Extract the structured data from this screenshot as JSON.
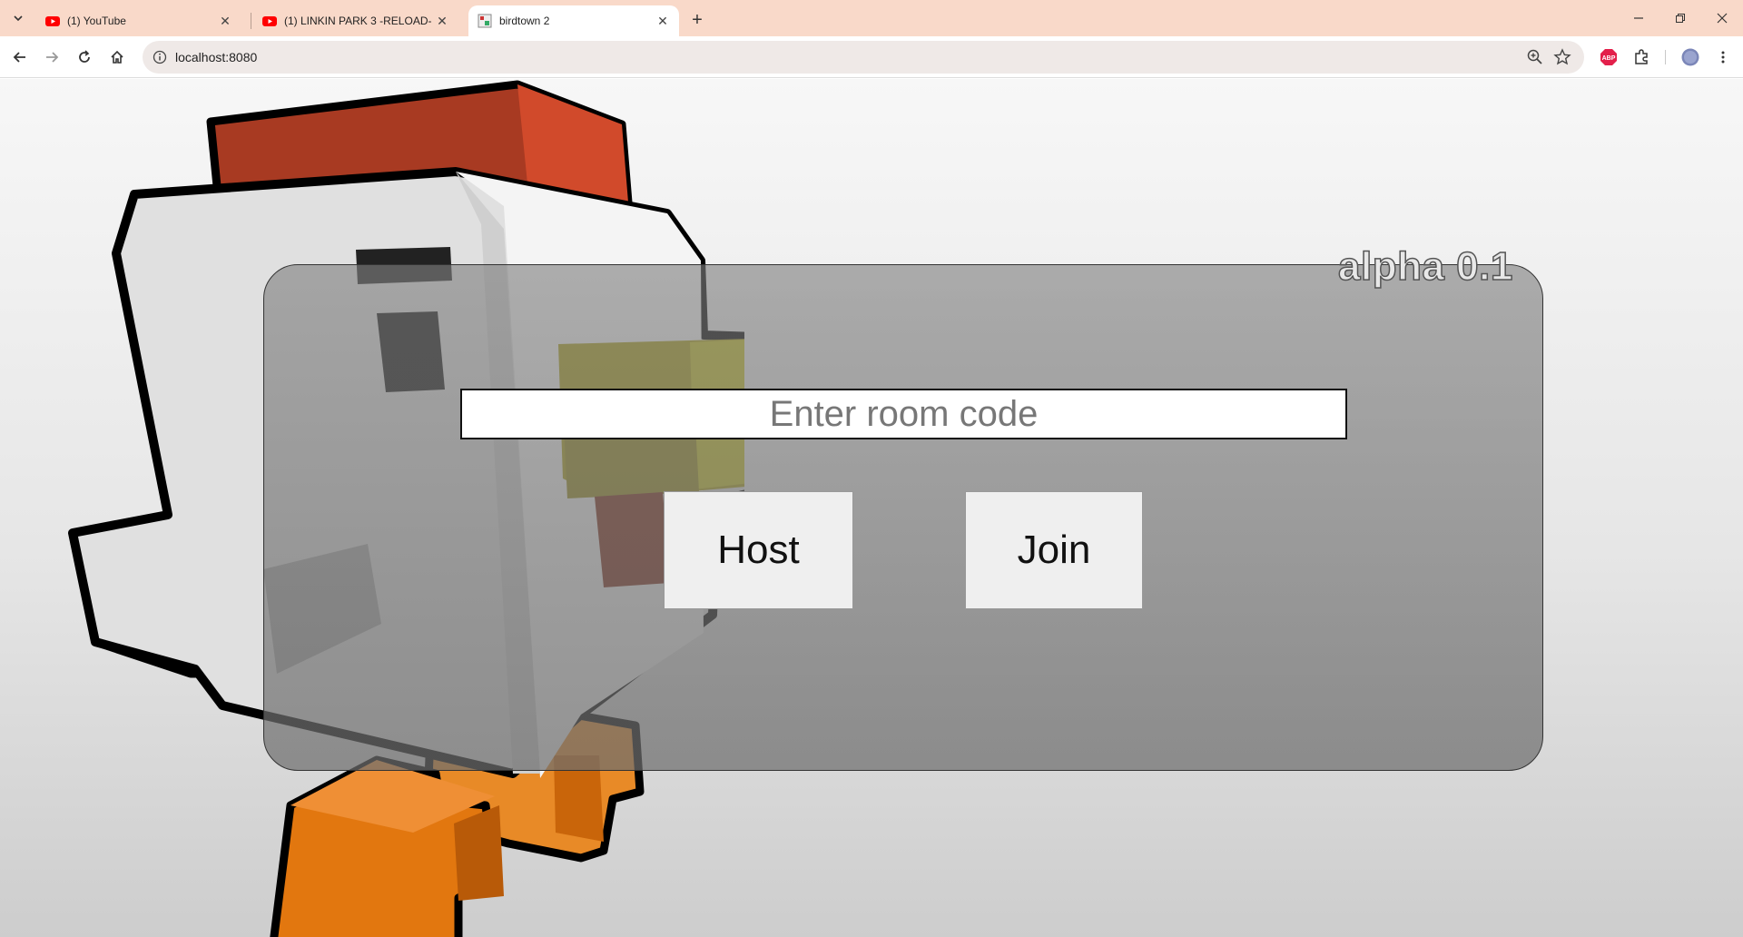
{
  "browser": {
    "tabs": [
      {
        "title": "(1) YouTube",
        "favicon": "youtube-icon",
        "active": false
      },
      {
        "title": "(1) LINKIN PARK 3 -RELOAD- (A",
        "favicon": "youtube-icon",
        "active": false
      },
      {
        "title": "birdtown 2",
        "favicon": "page-favicon-icon",
        "active": true
      }
    ],
    "address": "localhost:8080",
    "toolbar_icons": [
      "back-icon",
      "forward-icon",
      "reload-icon",
      "home-icon",
      "site-info-icon",
      "zoom-icon",
      "bookmark-star-icon",
      "adblock-extension-icon",
      "extensions-icon",
      "profile-avatar",
      "menu-kebab-icon"
    ],
    "window_controls": [
      "minimize-icon",
      "restore-icon",
      "close-icon"
    ]
  },
  "game": {
    "version_label": "alpha 0.1",
    "room_code_placeholder": "Enter room code",
    "room_code_value": "",
    "host_label": "Host",
    "join_label": "Join",
    "colors": {
      "panel": "#8c8c8c",
      "chicken_body": "#d9d9d9",
      "comb": "#c9452a",
      "beak": "#b8b020",
      "feet": "#e2770f"
    }
  }
}
